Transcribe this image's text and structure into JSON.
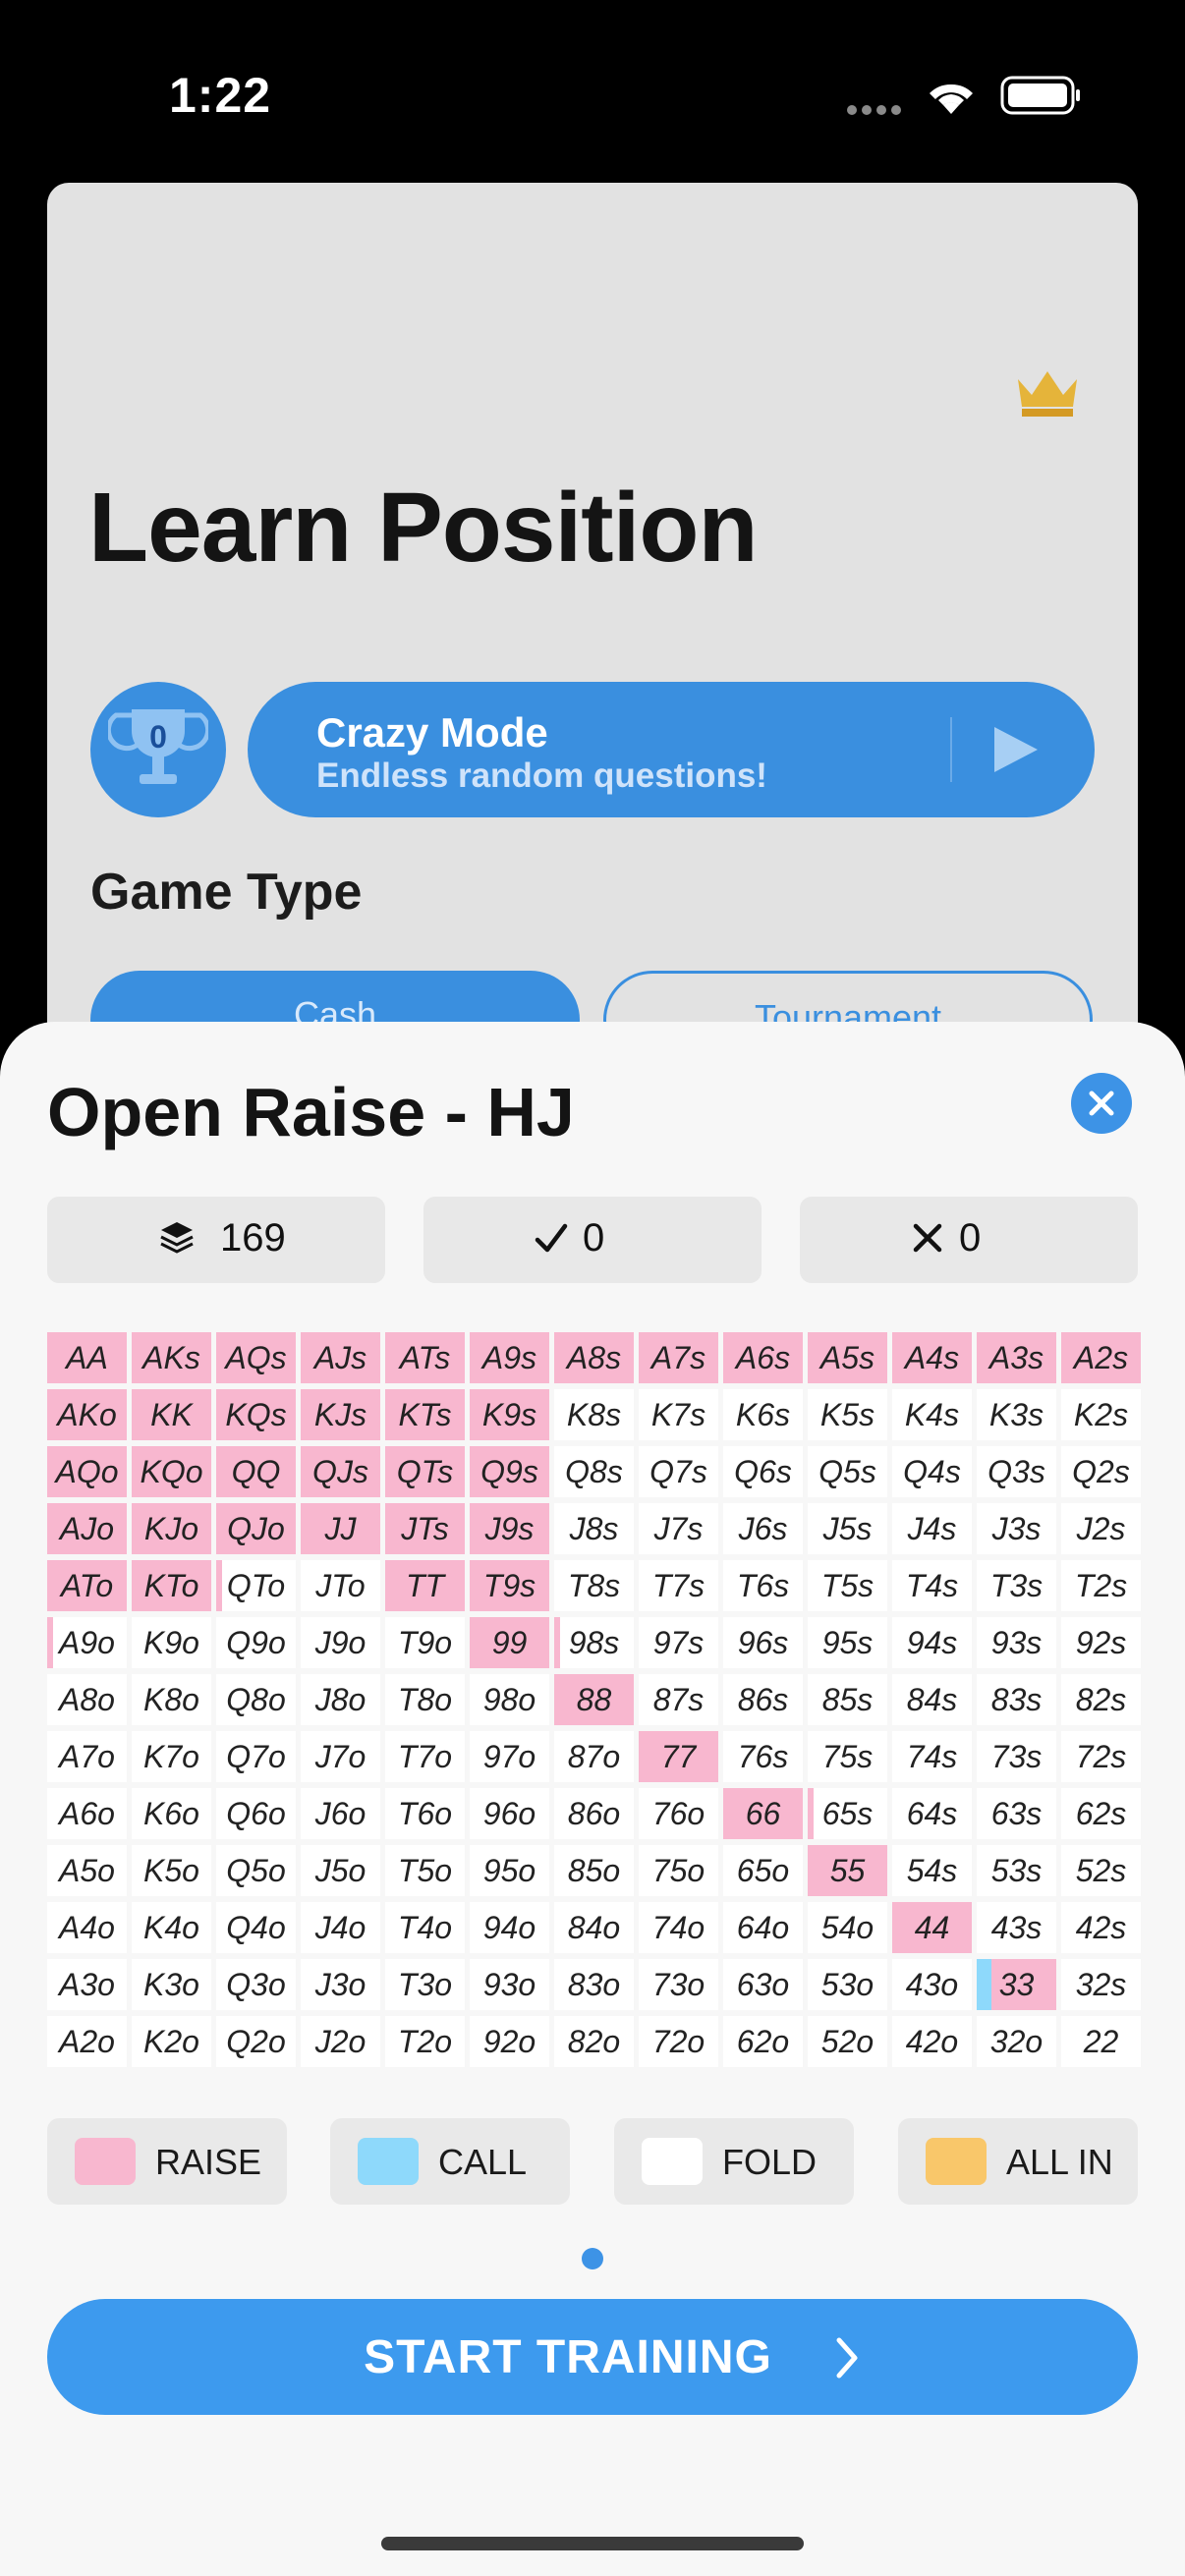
{
  "status_bar": {
    "time": "1:22"
  },
  "background": {
    "title": "Learn Position",
    "trophy_count": "0",
    "crazy_mode": {
      "title": "Crazy Mode",
      "subtitle": "Endless random questions!"
    },
    "game_type_label": "Game Type",
    "segments": {
      "cash": "Cash",
      "tournament": "Tournament"
    }
  },
  "sheet": {
    "title": "Open Raise - HJ",
    "stats": {
      "total": "169",
      "correct": "0",
      "wrong": "0"
    },
    "legend": [
      {
        "label": "RAISE",
        "color": "#f8b7cf"
      },
      {
        "label": "CALL",
        "color": "#8ed9fb"
      },
      {
        "label": "FOLD",
        "color": "#ffffff"
      },
      {
        "label": "ALL IN",
        "color": "#f9c76a"
      }
    ],
    "start_button": "START TRAINING",
    "range_colors": {
      "raise": "#f8b7cf",
      "call": "#8ed9fb"
    },
    "hand_matrix": [
      [
        "AA",
        "AKs",
        "AQs",
        "AJs",
        "ATs",
        "A9s",
        "A8s",
        "A7s",
        "A6s",
        "A5s",
        "A4s",
        "A3s",
        "A2s"
      ],
      [
        "AKo",
        "KK",
        "KQs",
        "KJs",
        "KTs",
        "K9s",
        "K8s",
        "K7s",
        "K6s",
        "K5s",
        "K4s",
        "K3s",
        "K2s"
      ],
      [
        "AQo",
        "KQo",
        "QQ",
        "QJs",
        "QTs",
        "Q9s",
        "Q8s",
        "Q7s",
        "Q6s",
        "Q5s",
        "Q4s",
        "Q3s",
        "Q2s"
      ],
      [
        "AJo",
        "KJo",
        "QJo",
        "JJ",
        "JTs",
        "J9s",
        "J8s",
        "J7s",
        "J6s",
        "J5s",
        "J4s",
        "J3s",
        "J2s"
      ],
      [
        "ATo",
        "KTo",
        "QTo",
        "JTo",
        "TT",
        "T9s",
        "T8s",
        "T7s",
        "T6s",
        "T5s",
        "T4s",
        "T3s",
        "T2s"
      ],
      [
        "A9o",
        "K9o",
        "Q9o",
        "J9o",
        "T9o",
        "99",
        "98s",
        "97s",
        "96s",
        "95s",
        "94s",
        "93s",
        "92s"
      ],
      [
        "A8o",
        "K8o",
        "Q8o",
        "J8o",
        "T8o",
        "98o",
        "88",
        "87s",
        "86s",
        "85s",
        "84s",
        "83s",
        "82s"
      ],
      [
        "A7o",
        "K7o",
        "Q7o",
        "J7o",
        "T7o",
        "97o",
        "87o",
        "77",
        "76s",
        "75s",
        "74s",
        "73s",
        "72s"
      ],
      [
        "A6o",
        "K6o",
        "Q6o",
        "J6o",
        "T6o",
        "96o",
        "86o",
        "76o",
        "66",
        "65s",
        "64s",
        "63s",
        "62s"
      ],
      [
        "A5o",
        "K5o",
        "Q5o",
        "J5o",
        "T5o",
        "95o",
        "85o",
        "75o",
        "65o",
        "55",
        "54s",
        "53s",
        "52s"
      ],
      [
        "A4o",
        "K4o",
        "Q4o",
        "J4o",
        "T4o",
        "94o",
        "84o",
        "74o",
        "64o",
        "54o",
        "44",
        "43s",
        "42s"
      ],
      [
        "A3o",
        "K3o",
        "Q3o",
        "J3o",
        "T3o",
        "93o",
        "83o",
        "73o",
        "63o",
        "53o",
        "43o",
        "33",
        "32s"
      ],
      [
        "A2o",
        "K2o",
        "Q2o",
        "J2o",
        "T2o",
        "92o",
        "82o",
        "72o",
        "62o",
        "52o",
        "42o",
        "32o",
        "22"
      ]
    ],
    "raise_fractions": [
      [
        1,
        1,
        1,
        1,
        1,
        1,
        1,
        1,
        1,
        1,
        1,
        1,
        1
      ],
      [
        1,
        1,
        1,
        1,
        1,
        1,
        0,
        0,
        0,
        0,
        0,
        0,
        0
      ],
      [
        1,
        1,
        1,
        1,
        1,
        1,
        0,
        0,
        0,
        0,
        0,
        0,
        0
      ],
      [
        1,
        1,
        1,
        1,
        1,
        1,
        0,
        0,
        0,
        0,
        0,
        0,
        0
      ],
      [
        1,
        1,
        0.08,
        0,
        1,
        1,
        0,
        0,
        0,
        0,
        0,
        0,
        0
      ],
      [
        0.08,
        0,
        0,
        0,
        0,
        1,
        0.08,
        0,
        0,
        0,
        0,
        0,
        0
      ],
      [
        0,
        0,
        0,
        0,
        0,
        0,
        1,
        0,
        0,
        0,
        0,
        0,
        0
      ],
      [
        0,
        0,
        0,
        0,
        0,
        0,
        0,
        1,
        0,
        0,
        0,
        0,
        0
      ],
      [
        0,
        0,
        0,
        0,
        0,
        0,
        0,
        0,
        1,
        0.08,
        0,
        0,
        0
      ],
      [
        0,
        0,
        0,
        0,
        0,
        0,
        0,
        0,
        0,
        1,
        0,
        0,
        0
      ],
      [
        0,
        0,
        0,
        0,
        0,
        0,
        0,
        0,
        0,
        0,
        1,
        0,
        0
      ],
      [
        0,
        0,
        0,
        0,
        0,
        0,
        0,
        0,
        0,
        0,
        0,
        0.82,
        0
      ],
      [
        0,
        0,
        0,
        0,
        0,
        0,
        0,
        0,
        0,
        0,
        0,
        0,
        0
      ]
    ],
    "call_fractions": [
      [
        0,
        0,
        0,
        0,
        0,
        0,
        0,
        0,
        0,
        0,
        0,
        0,
        0
      ],
      [
        0,
        0,
        0,
        0,
        0,
        0,
        0,
        0,
        0,
        0,
        0,
        0,
        0
      ],
      [
        0,
        0,
        0,
        0,
        0,
        0,
        0,
        0,
        0,
        0,
        0,
        0,
        0
      ],
      [
        0,
        0,
        0,
        0,
        0,
        0,
        0,
        0,
        0,
        0,
        0,
        0,
        0
      ],
      [
        0,
        0,
        0,
        0,
        0,
        0,
        0,
        0,
        0,
        0,
        0,
        0,
        0
      ],
      [
        0,
        0,
        0,
        0,
        0,
        0,
        0,
        0,
        0,
        0,
        0,
        0,
        0
      ],
      [
        0,
        0,
        0,
        0,
        0,
        0,
        0,
        0,
        0,
        0,
        0,
        0,
        0
      ],
      [
        0,
        0,
        0,
        0,
        0,
        0,
        0,
        0,
        0,
        0,
        0,
        0,
        0
      ],
      [
        0,
        0,
        0,
        0,
        0,
        0,
        0,
        0,
        0,
        0,
        0,
        0,
        0
      ],
      [
        0,
        0,
        0,
        0,
        0,
        0,
        0,
        0,
        0,
        0,
        0,
        0,
        0
      ],
      [
        0,
        0,
        0,
        0,
        0,
        0,
        0,
        0,
        0,
        0,
        0,
        0,
        0
      ],
      [
        0,
        0,
        0,
        0,
        0,
        0,
        0,
        0,
        0,
        0,
        0,
        0.18,
        0
      ],
      [
        0,
        0,
        0,
        0,
        0,
        0,
        0,
        0,
        0,
        0,
        0,
        0,
        0
      ]
    ]
  }
}
